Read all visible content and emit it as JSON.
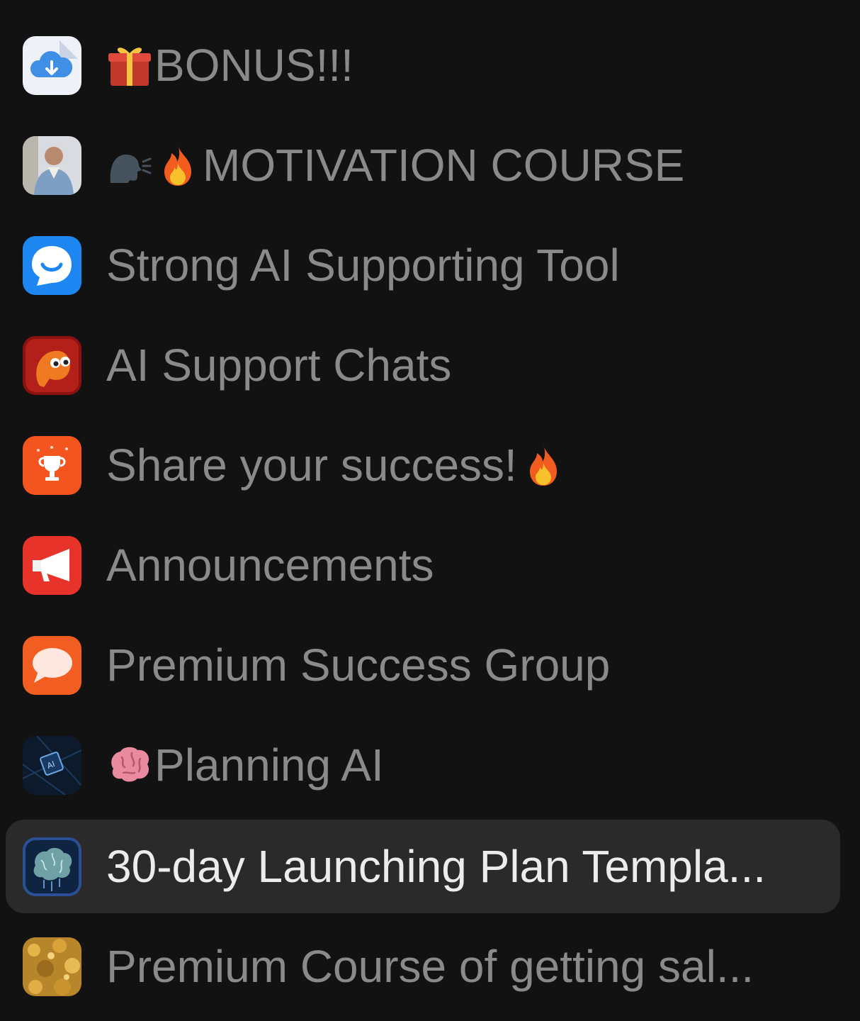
{
  "channels": [
    {
      "label": "BONUS!!!",
      "icon": "cloud-download-icon",
      "prefix_emoji": [
        "gift-emoji"
      ],
      "suffix_emoji": [],
      "active": false
    },
    {
      "label": "MOTIVATION COURSE",
      "icon": "avatar-man-photo-icon",
      "prefix_emoji": [
        "speaking-head-emoji",
        "fire-emoji"
      ],
      "suffix_emoji": [],
      "active": false
    },
    {
      "label": "Strong AI Supporting Tool",
      "icon": "smile-chat-bubble-icon",
      "prefix_emoji": [],
      "suffix_emoji": [],
      "active": false
    },
    {
      "label": "AI Support Chats",
      "icon": "orange-ghost-icon",
      "prefix_emoji": [],
      "suffix_emoji": [],
      "active": false
    },
    {
      "label": "Share your success!",
      "icon": "trophy-icon",
      "prefix_emoji": [],
      "suffix_emoji": [
        "fire-emoji"
      ],
      "active": false
    },
    {
      "label": "Announcements",
      "icon": "megaphone-icon",
      "prefix_emoji": [],
      "suffix_emoji": [],
      "active": false
    },
    {
      "label": "Premium Success Group",
      "icon": "speech-bubble-icon",
      "prefix_emoji": [],
      "suffix_emoji": [],
      "active": false
    },
    {
      "label": "Planning AI",
      "icon": "ai-chip-icon",
      "prefix_emoji": [
        "brain-emoji"
      ],
      "suffix_emoji": [],
      "active": false
    },
    {
      "label": "30-day Launching Plan Templa...",
      "icon": "digital-brain-icon",
      "prefix_emoji": [],
      "suffix_emoji": [],
      "active": true
    },
    {
      "label": "Premium Course of getting sal...",
      "icon": "gold-texture-icon",
      "prefix_emoji": [],
      "suffix_emoji": [],
      "active": false
    }
  ],
  "colors": {
    "background": "#121212",
    "active_row": "#2a2a2a",
    "label": "#8a8a8a",
    "label_active": "#ececec"
  }
}
